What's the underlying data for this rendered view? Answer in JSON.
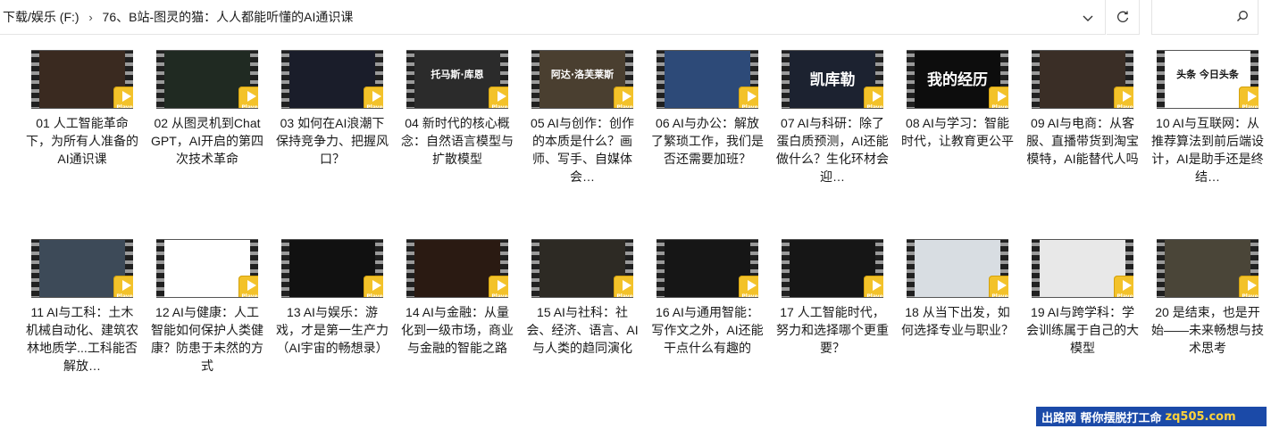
{
  "address": {
    "crumbs": [
      "下载/娱乐 (F:)",
      "76、B站-图灵的猫：人人都能听懂的AI通识课"
    ]
  },
  "search": {
    "placeholder": ""
  },
  "player_badge": "Player",
  "items": [
    {
      "label": "01 人工智能革命下，为所有人准备的AI通识课",
      "thumb_text": ""
    },
    {
      "label": "02 从图灵机到ChatGPT，AI开启的第四次技术革命",
      "thumb_text": ""
    },
    {
      "label": "03 如何在AI浪潮下保持竞争力、把握风口？",
      "thumb_text": ""
    },
    {
      "label": "04 新时代的核心概念：自然语言模型与扩散模型",
      "thumb_text": "托马斯·库恩"
    },
    {
      "label": "05 AI与创作：创作的本质是什么？画师、写手、自媒体会…",
      "thumb_text": "阿达·洛芙莱斯"
    },
    {
      "label": "06 AI与办公：解放了繁琐工作，我们是否还需要加班？",
      "thumb_text": ""
    },
    {
      "label": "07 AI与科研：除了蛋白质预测，AI还能做什么？生化环材会迎…",
      "thumb_text": "凯库勒"
    },
    {
      "label": "08 AI与学习：智能时代，让教育更公平",
      "thumb_text": "我的经历"
    },
    {
      "label": "09 AI与电商：从客服、直播带货到淘宝模特，AI能替代人吗",
      "thumb_text": ""
    },
    {
      "label": "10 AI与互联网：从推荐算法到前后端设计，AI是助手还是终结…",
      "thumb_text": "头条 今日头条"
    },
    {
      "label": "11 AI与工科：土木机械自动化、建筑农林地质学...工科能否解放…",
      "thumb_text": ""
    },
    {
      "label": "12 AI与健康：人工智能如何保护人类健康？防患于未然的方式",
      "thumb_text": ""
    },
    {
      "label": "13 AI与娱乐：游戏，才是第一生产力（AI宇宙的畅想录）",
      "thumb_text": ""
    },
    {
      "label": "14 AI与金融：从量化到一级市场，商业与金融的智能之路",
      "thumb_text": ""
    },
    {
      "label": "15 AI与社科：社会、经济、语言、AI与人类的趋同演化",
      "thumb_text": ""
    },
    {
      "label": "16 AI与通用智能：写作文之外，AI还能干点什么有趣的",
      "thumb_text": ""
    },
    {
      "label": "17 人工智能时代，努力和选择哪个更重要？",
      "thumb_text": ""
    },
    {
      "label": "18 从当下出发，如何选择专业与职业？",
      "thumb_text": ""
    },
    {
      "label": "19 AI与跨学科：学会训练属于自己的大模型",
      "thumb_text": ""
    },
    {
      "label": "20 是结束，也是开始——未来畅想与技术思考",
      "thumb_text": ""
    }
  ],
  "watermark": {
    "text": "出路网 帮你摆脱打工命",
    "domain": "zq505.com"
  }
}
